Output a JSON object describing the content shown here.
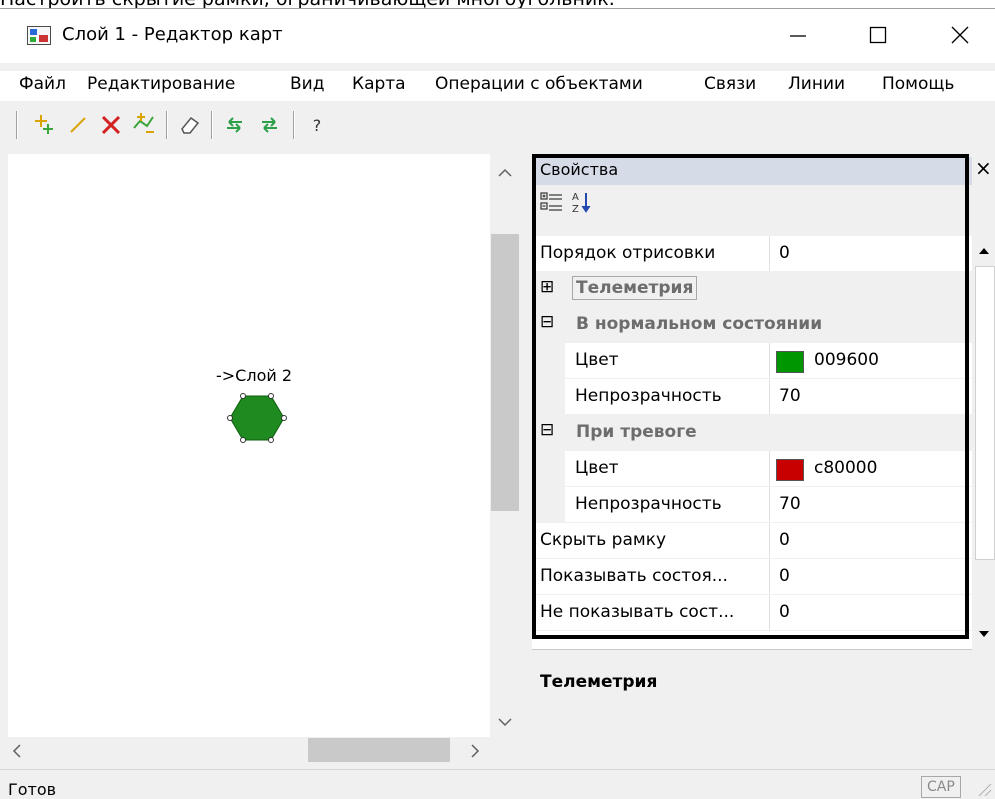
{
  "caption": {
    "text": "Настроить скрытие рамки, ограничивающей многоугольник."
  },
  "window": {
    "title": "Слой 1 - Редактор карт"
  },
  "menu": {
    "items": [
      "Файл",
      "Редактирование",
      "Вид",
      "Карта",
      "Операции с объектами",
      "Связи",
      "Линии",
      "Помощь"
    ]
  },
  "toolbar": {
    "icons": [
      "add-point-icon",
      "draw-line-icon",
      "delete-icon",
      "edit-vertices-icon",
      "eraser-icon",
      "undo-icon",
      "redo-icon",
      "help-icon"
    ],
    "help_label": "?"
  },
  "map": {
    "object_label": "->Слой 2",
    "object_color": "#1f8a1f"
  },
  "properties": {
    "title": "Свойства",
    "close_label": "×",
    "rows": [
      {
        "name": "Порядок отрисовки",
        "value": "0"
      },
      {
        "name": "Телеметрия"
      },
      {
        "name": "В нормальном состоянии"
      },
      {
        "name": "Цвет",
        "value": "009600",
        "color": "#009600"
      },
      {
        "name": "Непрозрачность",
        "value": "70"
      },
      {
        "name": "При тревоге"
      },
      {
        "name": "Цвет",
        "value": "c80000",
        "color": "#c80000"
      },
      {
        "name": "Непрозрачность",
        "value": "70"
      },
      {
        "name": "Скрыть рамку",
        "value": "0"
      },
      {
        "name": "Показывать состоя...",
        "value": "0"
      },
      {
        "name": "Не показывать сост...",
        "value": "0"
      }
    ],
    "description_title": "Телеметрия",
    "expand_symbol": "⊞",
    "collapse_symbol": "⊟"
  },
  "status": {
    "text": "Готов",
    "indicator": "CAP"
  },
  "colors": {
    "highlight_border": "#000000",
    "title_bar": "#d5dce8"
  }
}
